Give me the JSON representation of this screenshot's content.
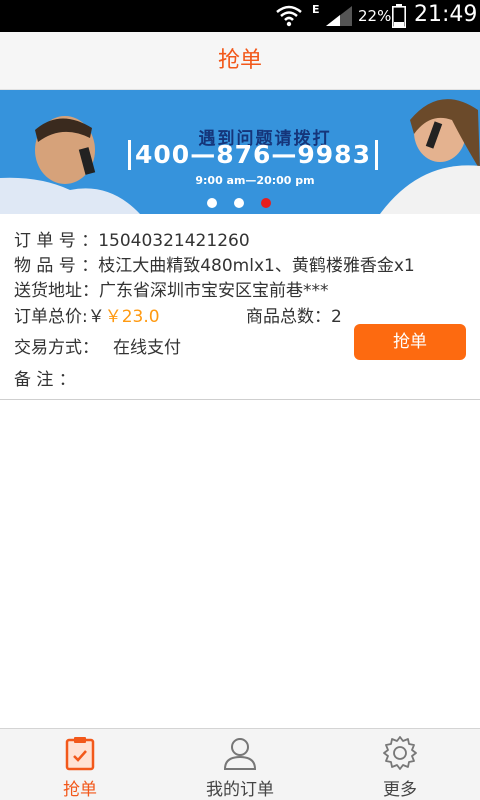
{
  "status_bar": {
    "network_type": "E",
    "battery_percent": "22%",
    "time": "21:49"
  },
  "header": {
    "title": "抢单"
  },
  "banner": {
    "title": "遇到问题请拨打",
    "phone": "400—876—9983",
    "hours": "9:00 am—20:00 pm",
    "slide_count": 3,
    "active_slide": 3
  },
  "order": {
    "order_no_label": "订 单 号 ：",
    "order_no": "15040321421260",
    "item_no_label": "物 品 号 ：",
    "item_no": "枝江大曲精致480mlx1、黄鹤楼雅香金x1",
    "address_label": "送货地址：",
    "address": "广东省深圳市宝安区宝前巷***",
    "total_label": "订单总价:￥",
    "total_value": "￥23.0",
    "count_label": "商品总数：",
    "count_value": "2",
    "payment_label": "交易方式：",
    "payment_value": "在线支付",
    "remark_label": "备 注 ：",
    "grab_button_label": "抢单"
  },
  "bottom_nav": {
    "items": [
      {
        "label": "抢单",
        "icon": "clipboard-check-icon",
        "active": true
      },
      {
        "label": "我的订单",
        "icon": "user-icon",
        "active": false
      },
      {
        "label": "更多",
        "icon": "gear-icon",
        "active": false
      }
    ]
  },
  "colors": {
    "accent": "#f2581a",
    "button": "#fd6a10",
    "price": "#ff9a12",
    "banner_bg": "#2a86d3",
    "active_dot": "#e61e1e"
  }
}
